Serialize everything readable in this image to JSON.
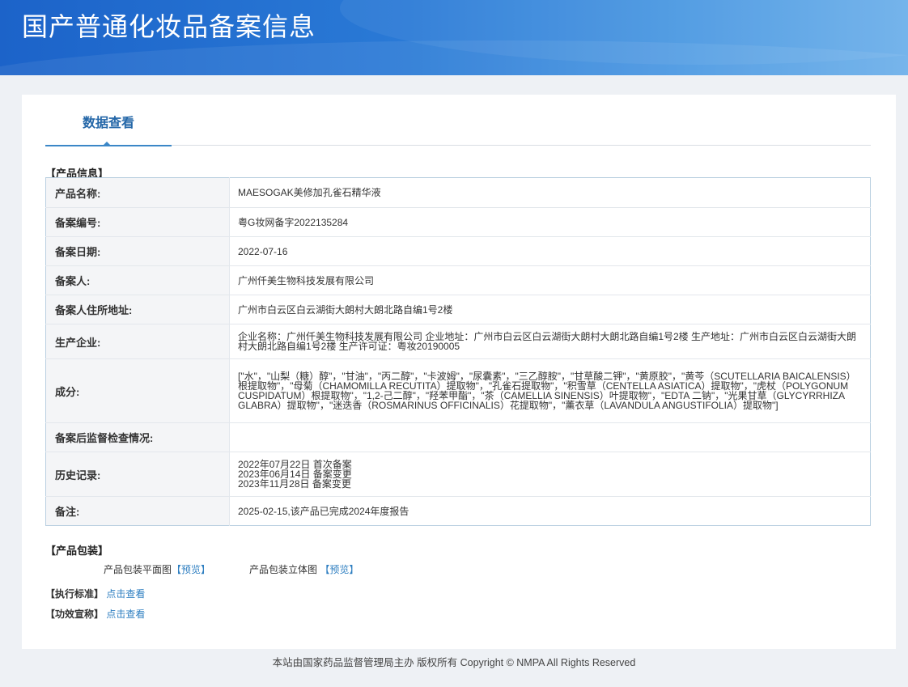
{
  "header": {
    "title": "国产普通化妆品备案信息"
  },
  "tabs": [
    {
      "label": "数据查看"
    }
  ],
  "product_info": {
    "section_label": "【产品信息】",
    "rows": [
      {
        "key": "产品名称:",
        "value": "MAESOGAK美修加孔雀石精华液"
      },
      {
        "key": "备案编号:",
        "value": "粤G妆网备字2022135284"
      },
      {
        "key": "备案日期:",
        "value": "2022-07-16"
      },
      {
        "key": "备案人:",
        "value": "广州仟美生物科技发展有限公司"
      },
      {
        "key": "备案人住所地址:",
        "value": "广州市白云区白云湖街大朗村大朗北路自编1号2楼"
      },
      {
        "key": "生产企业:",
        "value": "企业名称：广州仟美生物科技发展有限公司 企业地址：广州市白云区白云湖街大朗村大朗北路自编1号2楼 生产地址：广州市白云区白云湖街大朗村大朗北路自编1号2楼 生产许可证：粤妆20190005"
      },
      {
        "key": "成分:",
        "value": "[\"水\"，\"山梨（糖）醇\"，\"甘油\"，\"丙二醇\"，\"卡波姆\"，\"尿囊素\"，\"三乙醇胺\"，\"甘草酸二钾\"，\"黄原胶\"，\"黄芩（SCUTELLARIA BAICALENSIS）根提取物\"，\"母菊（CHAMOMILLA RECUTITA）提取物\"，\"孔雀石提取物\"，\"积雪草（CENTELLA ASIATICA）提取物\"，\"虎杖（POLYGONUM CUSPIDATUM）根提取物\"，\"1,2-己二醇\"，\"羟苯甲酯\"，\"茶（CAMELLIA SINENSIS）叶提取物\"，\"EDTA 二钠\"，\"光果甘草（GLYCYRRHIZA GLABRA）提取物\"，\"迷迭香（ROSMARINUS OFFICINALIS）花提取物\"，\"薰衣草（LAVANDULA ANGUSTIFOLIA）提取物\"]"
      },
      {
        "key": "备案后监督检查情况:",
        "value": ""
      },
      {
        "key": "历史记录:",
        "value": "2022年07月22日 首次备案\n2023年06月14日 备案变更\n2023年11月28日 备案变更"
      },
      {
        "key": "备注:",
        "value": "2025-02-15,该产品已完成2024年度报告"
      }
    ]
  },
  "packaging": {
    "section_label": "【产品包装】",
    "flat_label": "产品包装平面图",
    "flat_link": "【预览】",
    "solid_label": "产品包装立体图",
    "solid_link": "【预览】"
  },
  "standard": {
    "label": "【执行标准】",
    "link": "点击查看"
  },
  "efficacy": {
    "label": "【功效宣称】",
    "link": "点击查看"
  },
  "footer": {
    "text": "本站由国家药品监督管理局主办 版权所有 Copyright © NMPA All Rights Reserved"
  }
}
